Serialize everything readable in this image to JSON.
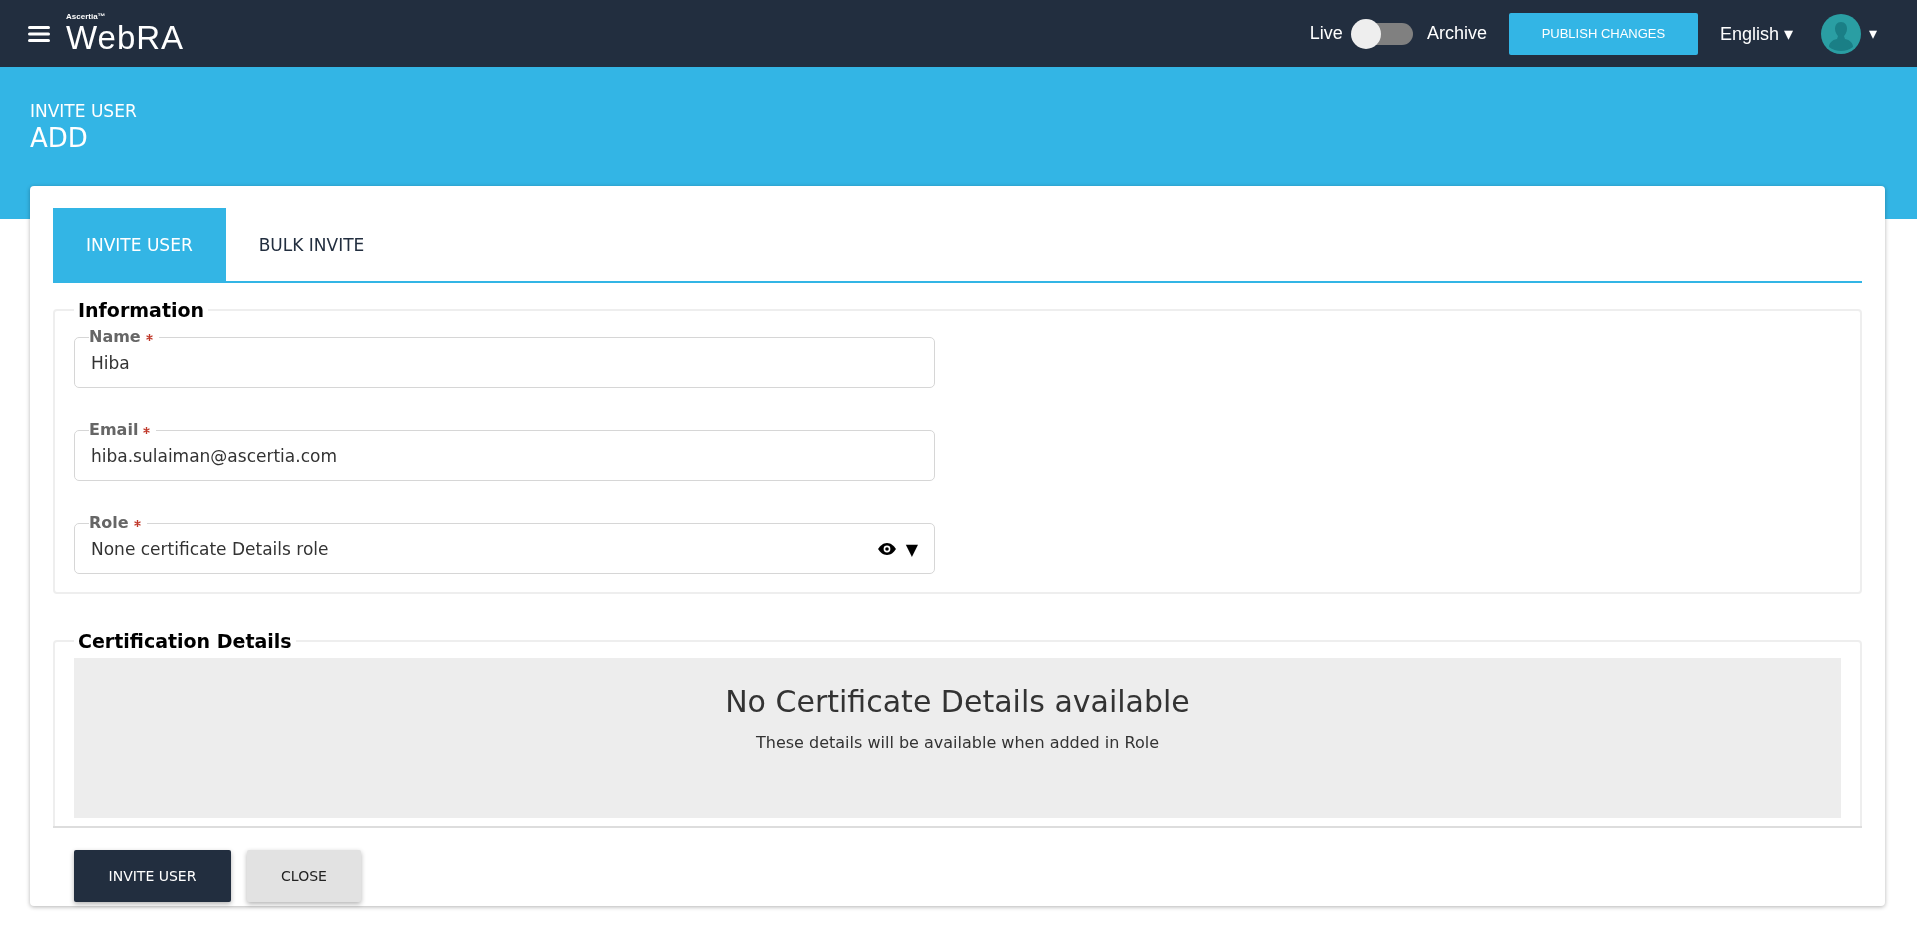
{
  "header": {
    "brand_small": "Ascertia™",
    "brand": "WebRA",
    "toggle": {
      "left_label": "Live",
      "right_label": "Archive",
      "on": false
    },
    "publish_button": "PUBLISH CHANGES",
    "language": "English ▾",
    "avatar_caret": "▾"
  },
  "page": {
    "subtitle": "INVITE USER",
    "title": "ADD"
  },
  "tabs": [
    {
      "label": "INVITE USER",
      "selected": true
    },
    {
      "label": "BULK INVITE",
      "selected": false
    }
  ],
  "sections": [
    {
      "title": "Information",
      "fields": [
        {
          "label": "Name",
          "required": true,
          "value": "Hiba",
          "kind": "text"
        },
        {
          "label": "Email",
          "required": true,
          "value": "hiba.sulaiman@ascertia.com",
          "kind": "text"
        },
        {
          "label": "Role",
          "required": true,
          "value": "None certificate Details role",
          "kind": "select",
          "caret": "▼"
        }
      ]
    },
    {
      "title": "Certification Details",
      "empty": {
        "heading": "No Certificate Details available",
        "message": "These details will be available when added in Role"
      }
    }
  ],
  "buttons": [
    {
      "label": "INVITE USER",
      "kind": "primary"
    },
    {
      "label": "CLOSE",
      "kind": "secondary"
    }
  ]
}
